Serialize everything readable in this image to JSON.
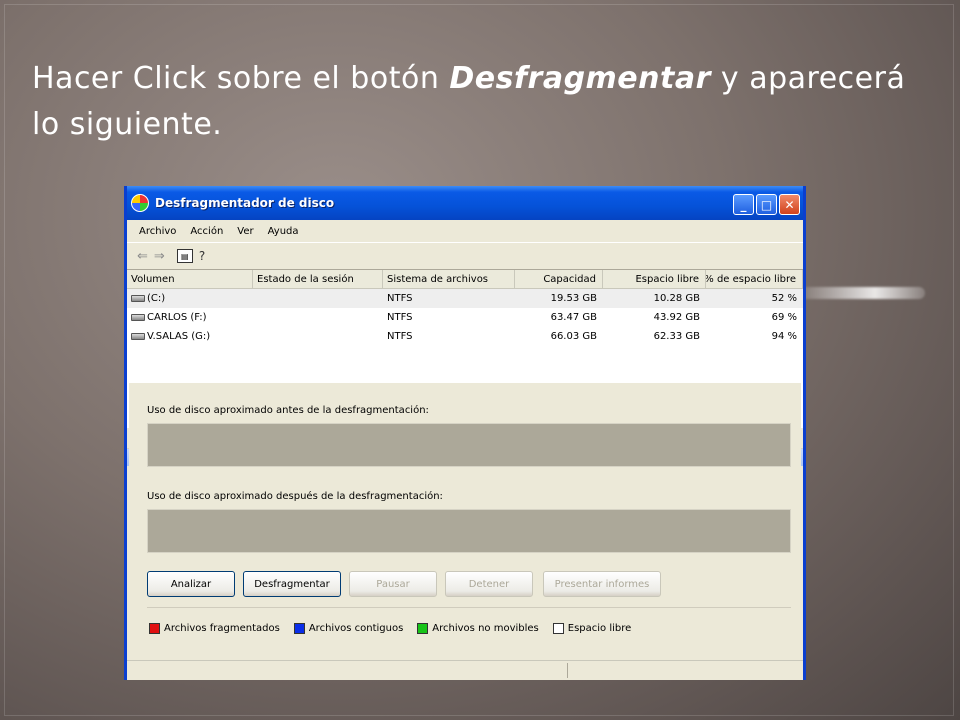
{
  "slide": {
    "heading_pre": "Hacer Click sobre el botón ",
    "heading_em": "Desfragmentar",
    "heading_post": "  y aparecerá lo siguiente."
  },
  "window": {
    "title": "Desfragmentador de disco",
    "controls": {
      "minimize": "_",
      "maximize": "□",
      "close": "✕"
    },
    "menu": [
      "Archivo",
      "Acción",
      "Ver",
      "Ayuda"
    ],
    "toolbar_icons": [
      "back-arrow-icon",
      "forward-arrow-icon",
      "properties-icon",
      "help-icon"
    ],
    "columns": [
      "Volumen",
      "Estado de la sesión",
      "Sistema de archivos",
      "Capacidad",
      "Espacio libre",
      "% de espacio libre"
    ],
    "volumes": [
      {
        "name": "(C:)",
        "status": "",
        "fs": "NTFS",
        "capacity": "19.53 GB",
        "free": "10.28 GB",
        "pct": "52 %"
      },
      {
        "name": "CARLOS (F:)",
        "status": "",
        "fs": "NTFS",
        "capacity": "63.47 GB",
        "free": "43.92 GB",
        "pct": "69 %"
      },
      {
        "name": "V.SALAS (G:)",
        "status": "",
        "fs": "NTFS",
        "capacity": "66.03 GB",
        "free": "62.33 GB",
        "pct": "94 %"
      }
    ],
    "before_label": "Uso de disco aproximado antes de la desfragmentación:",
    "after_label": "Uso de disco aproximado después de la desfragmentación:",
    "buttons": {
      "analyze": "Analizar",
      "defrag": "Desfragmentar",
      "pause": "Pausar",
      "stop": "Detener",
      "report": "Presentar informes"
    },
    "legend": [
      {
        "label": "Archivos fragmentados",
        "color": "#e01010"
      },
      {
        "label": "Archivos contiguos",
        "color": "#0a2ee8"
      },
      {
        "label": "Archivos no movibles",
        "color": "#18c418"
      },
      {
        "label": "Espacio libre",
        "color": "#ffffff"
      }
    ]
  }
}
